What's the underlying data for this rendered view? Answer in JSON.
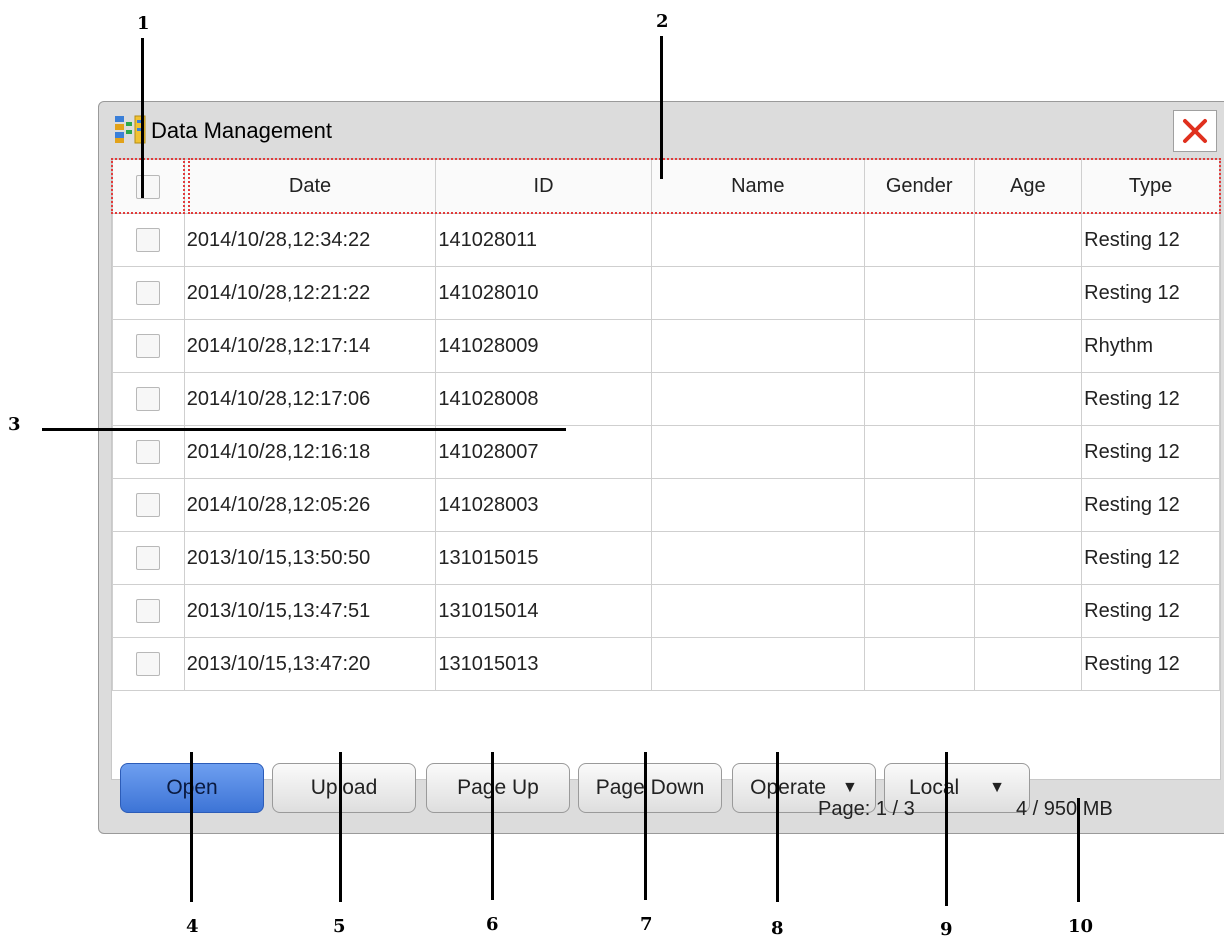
{
  "callouts": [
    "1",
    "2",
    "3",
    "4",
    "5",
    "6",
    "7",
    "8",
    "9",
    "10"
  ],
  "window": {
    "title": "Data Management",
    "icon": "data-management-icon",
    "close_icon": "close-icon"
  },
  "table": {
    "columns": [
      "Date",
      "ID",
      "Name",
      "Gender",
      "Age",
      "Type"
    ],
    "rows": [
      {
        "date": "2014/10/28,12:34:22",
        "id": "141028011",
        "name": "",
        "gender": "",
        "age": "",
        "type": "Resting 12"
      },
      {
        "date": "2014/10/28,12:21:22",
        "id": "141028010",
        "name": "",
        "gender": "",
        "age": "",
        "type": "Resting 12"
      },
      {
        "date": "2014/10/28,12:17:14",
        "id": "141028009",
        "name": "",
        "gender": "",
        "age": "",
        "type": "Rhythm"
      },
      {
        "date": "2014/10/28,12:17:06",
        "id": "141028008",
        "name": "",
        "gender": "",
        "age": "",
        "type": "Resting 12"
      },
      {
        "date": "2014/10/28,12:16:18",
        "id": "141028007",
        "name": "",
        "gender": "",
        "age": "",
        "type": "Resting 12"
      },
      {
        "date": "2014/10/28,12:05:26",
        "id": "141028003",
        "name": "",
        "gender": "",
        "age": "",
        "type": "Resting 12"
      },
      {
        "date": "2013/10/15,13:50:50",
        "id": "131015015",
        "name": "",
        "gender": "",
        "age": "",
        "type": "Resting 12"
      },
      {
        "date": "2013/10/15,13:47:51",
        "id": "131015014",
        "name": "",
        "gender": "",
        "age": "",
        "type": "Resting 12"
      },
      {
        "date": "2013/10/15,13:47:20",
        "id": "131015013",
        "name": "",
        "gender": "",
        "age": "",
        "type": "Resting 12"
      }
    ]
  },
  "buttons": {
    "open": "Open",
    "upload": "Upload",
    "page_up": "Page Up",
    "page_down": "Page Down",
    "operate": "Operate",
    "local": "Local",
    "dropdown_icon": "chevron-down-icon"
  },
  "status": {
    "page": "Page: 1 / 3",
    "storage": "4 / 950 MB"
  },
  "colors": {
    "primary_button": "#4a80df",
    "highlight_outline": "#e23b3b",
    "close_icon": "#e0301e"
  }
}
